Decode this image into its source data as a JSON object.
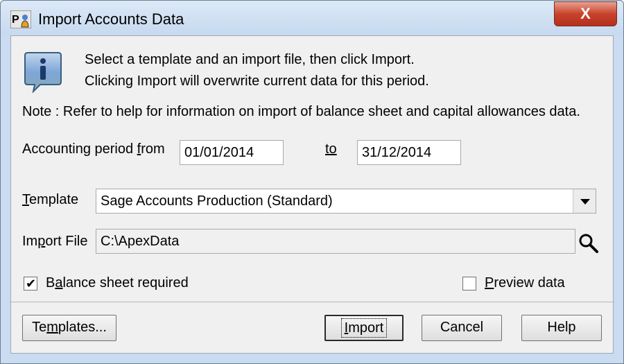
{
  "window": {
    "title": "Import Accounts Data",
    "close_label": "X"
  },
  "info": {
    "line1": "Select a template and an import file, then click Import.",
    "line2": "Clicking Import will overwrite current data for this period."
  },
  "note": "Note : Refer to help for information on import of balance sheet and capital allowances data.",
  "period": {
    "from_label_pre": "Accounting period ",
    "from_label_access": "f",
    "from_label_post": "rom",
    "from_value": "01/01/2014",
    "to_label": "to",
    "to_value": "31/12/2014"
  },
  "template": {
    "label_access": "T",
    "label_rest": "emplate",
    "value": "Sage Accounts Production (Standard)"
  },
  "import_file": {
    "label_pre": "Im",
    "label_access": "p",
    "label_post": "ort File",
    "value": "C:\\ApexData"
  },
  "options": {
    "balance_pre": "B",
    "balance_access": "a",
    "balance_post": "lance sheet required",
    "balance_checked": true,
    "preview_access": "P",
    "preview_post": "review data",
    "preview_checked": false
  },
  "buttons": {
    "templates_pre": "Te",
    "templates_access": "m",
    "templates_post": "plates...",
    "import_access": "I",
    "import_post": "mport",
    "cancel": "Cancel",
    "help": "Help"
  },
  "icons": {
    "info": "info-bubble-icon",
    "search": "magnifier-icon",
    "app": "app-icon"
  }
}
